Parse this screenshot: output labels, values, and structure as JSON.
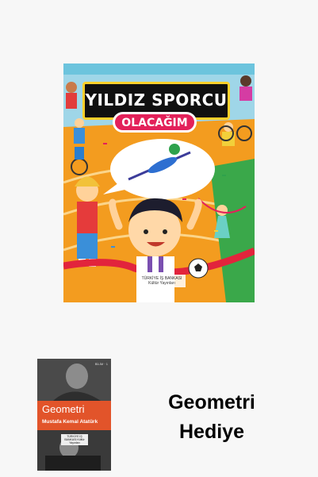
{
  "main_book": {
    "title": "YILDIZ SPORCU",
    "subtitle": "OLACAĞIM",
    "publisher": "TÜRKİYE İŞ BANKASI Kültür Yayınları"
  },
  "gift_book": {
    "series": "BİLİM · 1",
    "title": "Geometri",
    "author": "Mustafa Kemal Atatürk",
    "publisher": "TÜRKİYE İŞ BANKASI Kültür Yayınları"
  },
  "caption": {
    "line1": "Geometri",
    "line2": "Hediye"
  },
  "colors": {
    "background": "#f7f7f7",
    "cover_orange": "#f6a623",
    "title_box": "#101010",
    "subtitle_pink": "#e3215a",
    "gift_band": "#e2542a"
  }
}
